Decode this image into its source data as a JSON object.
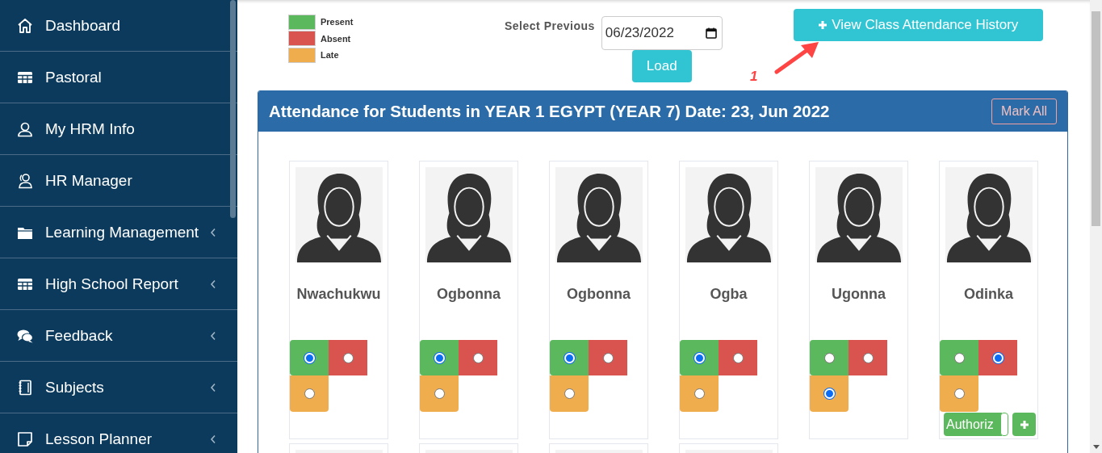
{
  "sidebar": {
    "items": [
      {
        "label": "Dashboard",
        "kind": "home",
        "expandable": false
      },
      {
        "label": "Pastoral",
        "kind": "grid",
        "expandable": false
      },
      {
        "label": "My HRM Info",
        "kind": "user",
        "expandable": false
      },
      {
        "label": "HR Manager",
        "kind": "users",
        "expandable": false
      },
      {
        "label": "Learning Management",
        "kind": "folder",
        "expandable": true
      },
      {
        "label": "High School Report",
        "kind": "grid",
        "expandable": true
      },
      {
        "label": "Feedback",
        "kind": "comments",
        "expandable": true
      },
      {
        "label": "Subjects",
        "kind": "notebook",
        "expandable": true
      },
      {
        "label": "Lesson Planner",
        "kind": "note",
        "expandable": true
      }
    ]
  },
  "legend": [
    {
      "label": "Present",
      "color": "#5cb85c"
    },
    {
      "label": "Absent",
      "color": "#d9534f"
    },
    {
      "label": "Late",
      "color": "#f0ad4e"
    }
  ],
  "select_previous": {
    "label": "Select Previous",
    "value": "06/23/2022",
    "button": "Load"
  },
  "history_button": "View Class Attendance History",
  "annotation": {
    "text": "1"
  },
  "panel": {
    "title": "Attendance for Students in YEAR 1 EGYPT (YEAR 7) Date: 23, Jun 2022",
    "mark_all": "Mark All",
    "students": [
      {
        "kind": "full",
        "name": "Nwachukwu",
        "options": [
          {
            "kind": "present",
            "selected": true
          },
          {
            "kind": "absent",
            "selected": false
          },
          {
            "kind": "late",
            "selected": false
          }
        ]
      },
      {
        "kind": "full",
        "name": "Ogbonna",
        "options": [
          {
            "kind": "present",
            "selected": true
          },
          {
            "kind": "absent",
            "selected": false
          },
          {
            "kind": "late",
            "selected": false
          }
        ]
      },
      {
        "kind": "full",
        "name": "Ogbonna",
        "options": [
          {
            "kind": "present",
            "selected": true
          },
          {
            "kind": "absent",
            "selected": false
          },
          {
            "kind": "late",
            "selected": false
          }
        ]
      },
      {
        "kind": "full",
        "name": "Ogba",
        "options": [
          {
            "kind": "present",
            "selected": true
          },
          {
            "kind": "absent",
            "selected": false
          },
          {
            "kind": "late",
            "selected": false
          }
        ]
      },
      {
        "kind": "full",
        "name": "Ugonna",
        "options": [
          {
            "kind": "present",
            "selected": false
          },
          {
            "kind": "absent",
            "selected": false
          },
          {
            "kind": "late",
            "selected": true
          }
        ]
      },
      {
        "kind": "full",
        "name": "Odinka",
        "options": [
          {
            "kind": "present",
            "selected": false
          },
          {
            "kind": "absent",
            "selected": true
          },
          {
            "kind": "late",
            "selected": false
          }
        ],
        "authorize_button": "Authoriz"
      },
      {
        "kind": "partial"
      },
      {
        "kind": "partial"
      },
      {
        "kind": "partial"
      },
      {
        "kind": "partial"
      }
    ]
  }
}
